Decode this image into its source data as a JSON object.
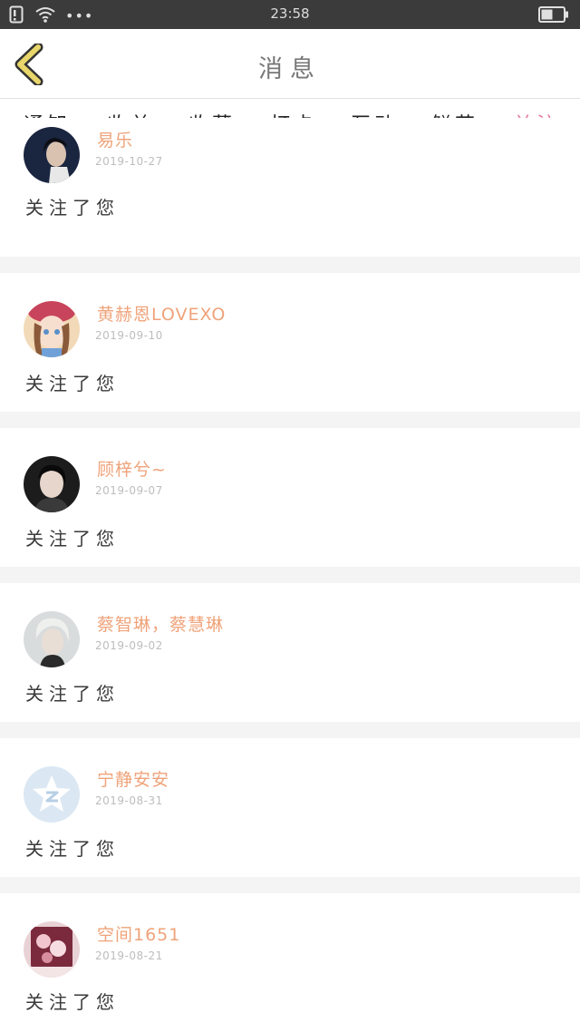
{
  "status_bar": {
    "time": "23:58",
    "icons": [
      "sim-alert-icon",
      "wifi-icon",
      "more-dots-icon",
      "battery-icon"
    ],
    "dots": "•••"
  },
  "header": {
    "title": "消息",
    "back_icon": "chevron-left-icon",
    "accent": "#e8d66b"
  },
  "tabs": {
    "items": [
      {
        "label": "通知"
      },
      {
        "label": "收益"
      },
      {
        "label": "收藏"
      },
      {
        "label": "打卡"
      },
      {
        "label": "互动"
      },
      {
        "label": "鲜花"
      },
      {
        "label": "关注"
      }
    ],
    "active_index": 6,
    "active_color": "#e67fa6"
  },
  "messages": [
    {
      "name": "易乐",
      "date": "2019-10-27",
      "text": "关注了您"
    },
    {
      "name": "黄赫恩LOVEXO",
      "date": "2019-09-10",
      "text": "关注了您"
    },
    {
      "name": "顾梓兮~",
      "date": "2019-09-07",
      "text": "关注了您"
    },
    {
      "name": "蔡智琳，蔡慧琳",
      "date": "2019-09-02",
      "text": "关注了您"
    },
    {
      "name": "宁静安安",
      "date": "2019-08-31",
      "text": "关注了您"
    },
    {
      "name": "空间1651",
      "date": "2019-08-21",
      "text": "关注了您"
    }
  ],
  "colors": {
    "name": "#efa37a",
    "date": "#bdbdbd",
    "separator": "#f4f4f4"
  }
}
